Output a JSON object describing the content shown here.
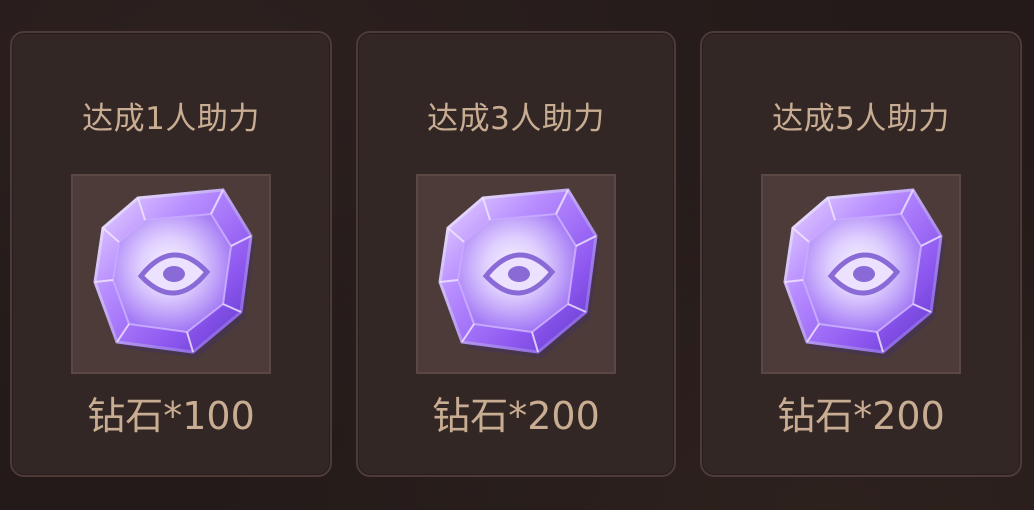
{
  "rewards": [
    {
      "title": "达成1人助力",
      "label": "钻石*100",
      "icon": "diamond-icon"
    },
    {
      "title": "达成3人助力",
      "label": "钻石*200",
      "icon": "diamond-icon"
    },
    {
      "title": "达成5人助力",
      "label": "钻石*200",
      "icon": "diamond-icon"
    }
  ],
  "colors": {
    "background": "#231a19",
    "card": "#332726",
    "text": "#c9ad92",
    "gem": "#9b6cf0"
  }
}
